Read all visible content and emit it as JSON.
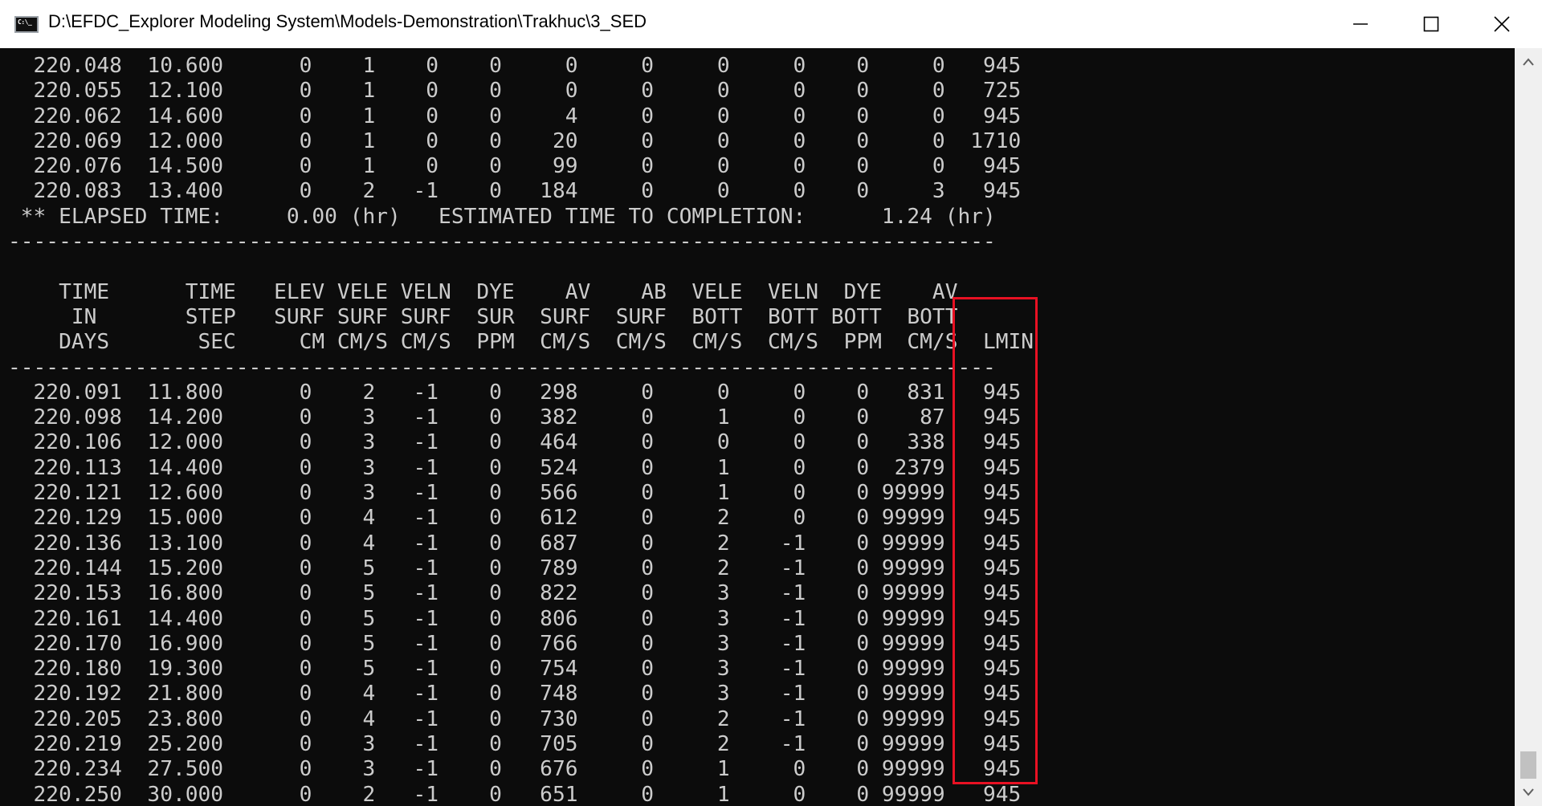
{
  "window": {
    "title": "D:\\EFDC_Explorer Modeling System\\Models-Demonstration\\Trakhuc\\3_SED",
    "app_icon": "console-icon",
    "controls": [
      "minimize-icon",
      "maximize-icon",
      "close-icon"
    ]
  },
  "console": {
    "lines": [
      "  220.048  10.600      0    1    0    0     0     0     0     0    0     0   945",
      "  220.055  12.100      0    1    0    0     0     0     0     0    0     0   725",
      "  220.062  14.600      0    1    0    0     4     0     0     0    0     0   945",
      "  220.069  12.000      0    1    0    0    20     0     0     0    0     0  1710",
      "  220.076  14.500      0    1    0    0    99     0     0     0    0     0   945",
      "  220.083  13.400      0    2   -1    0   184     0     0     0    0     3   945",
      " ** ELAPSED TIME:     0.00 (hr)   ESTIMATED TIME TO COMPLETION:      1.24 (hr)",
      "------------------------------------------------------------------------------",
      "",
      "    TIME      TIME   ELEV VELE VELN  DYE    AV    AB  VELE  VELN  DYE    AV",
      "     IN       STEP   SURF SURF SURF  SUR  SURF  SURF  BOTT  BOTT BOTT  BOTT",
      "    DAYS       SEC     CM CM/S CM/S  PPM  CM/S  CM/S  CM/S  CM/S  PPM  CM/S  LMIN",
      "------------------------------------------------------------------------------",
      "  220.091  11.800      0    2   -1    0   298     0     0     0    0   831   945",
      "  220.098  14.200      0    3   -1    0   382     0     1     0    0    87   945",
      "  220.106  12.000      0    3   -1    0   464     0     0     0    0   338   945",
      "  220.113  14.400      0    3   -1    0   524     0     1     0    0  2379   945",
      "  220.121  12.600      0    3   -1    0   566     0     1     0    0 99999   945",
      "  220.129  15.000      0    4   -1    0   612     0     2     0    0 99999   945",
      "  220.136  13.100      0    4   -1    0   687     0     2    -1    0 99999   945",
      "  220.144  15.200      0    5   -1    0   789     0     2    -1    0 99999   945",
      "  220.153  16.800      0    5   -1    0   822     0     3    -1    0 99999   945",
      "  220.161  14.400      0    5   -1    0   806     0     3    -1    0 99999   945",
      "  220.170  16.900      0    5   -1    0   766     0     3    -1    0 99999   945",
      "  220.180  19.300      0    5   -1    0   754     0     3    -1    0 99999   945",
      "  220.192  21.800      0    4   -1    0   748     0     3    -1    0 99999   945",
      "  220.205  23.800      0    4   -1    0   730     0     2    -1    0 99999   945",
      "  220.219  25.200      0    3   -1    0   705     0     2    -1    0 99999   945",
      "  220.234  27.500      0    3   -1    0   676     0     1     0    0 99999   945",
      "  220.250  30.000      0    2   -1    0   651     0     1     0    0 99999   945"
    ]
  },
  "colors": {
    "console_bg": "#0c0c0c",
    "console_text": "#cccccc",
    "highlight": "#e81123"
  }
}
